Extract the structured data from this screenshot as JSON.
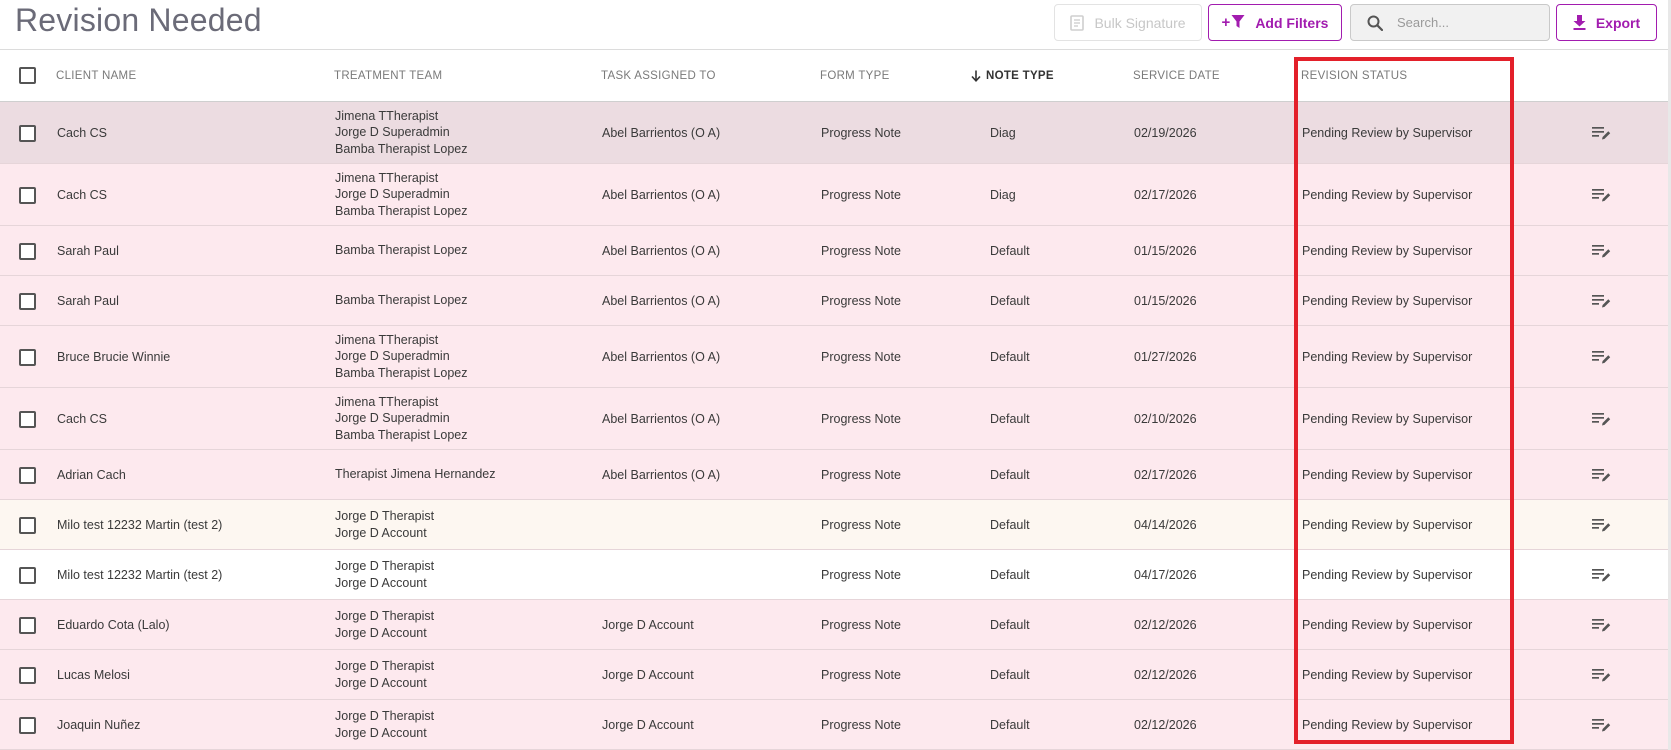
{
  "page": {
    "title": "Revision Needed"
  },
  "toolbar": {
    "bulk_signature_label": "Bulk Signature",
    "add_filters_label": "Add Filters",
    "search_placeholder": "Search...",
    "export_label": "Export",
    "accent_color": "#a21caf"
  },
  "table": {
    "columns": {
      "client_name": "CLIENT NAME",
      "treatment_team": "TREATMENT TEAM",
      "task_assigned_to": "TASK ASSIGNED TO",
      "form_type": "FORM TYPE",
      "note_type": "NOTE TYPE",
      "service_date": "SERVICE DATE",
      "revision_status": "REVISION STATUS"
    },
    "sorted_column": "NOTE TYPE",
    "sort_direction": "descending",
    "rows": [
      {
        "client": "Cach CS",
        "team": [
          "Jimena TTherapist",
          "Jorge D Superadmin",
          "Bamba Therapist Lopez"
        ],
        "assigned": "Abel Barrientos (O A)",
        "form": "Progress Note",
        "note": "Diag",
        "date": "02/19/2026",
        "status": "Pending Review by Supervisor",
        "bg": "#ecdce1"
      },
      {
        "client": "Cach CS",
        "team": [
          "Jimena TTherapist",
          "Jorge D Superadmin",
          "Bamba Therapist Lopez"
        ],
        "assigned": "Abel Barrientos (O A)",
        "form": "Progress Note",
        "note": "Diag",
        "date": "02/17/2026",
        "status": "Pending Review by Supervisor",
        "bg": "#fde9ee"
      },
      {
        "client": "Sarah Paul",
        "team": [
          "Bamba Therapist Lopez"
        ],
        "assigned": "Abel Barrientos (O A)",
        "form": "Progress Note",
        "note": "Default",
        "date": "01/15/2026",
        "status": "Pending Review by Supervisor",
        "bg": "#fde9ee"
      },
      {
        "client": "Sarah Paul",
        "team": [
          "Bamba Therapist Lopez"
        ],
        "assigned": "Abel Barrientos (O A)",
        "form": "Progress Note",
        "note": "Default",
        "date": "01/15/2026",
        "status": "Pending Review by Supervisor",
        "bg": "#fde9ee"
      },
      {
        "client": "Bruce Brucie Winnie",
        "team": [
          "Jimena TTherapist",
          "Jorge D Superadmin",
          "Bamba Therapist Lopez"
        ],
        "assigned": "Abel Barrientos (O A)",
        "form": "Progress Note",
        "note": "Default",
        "date": "01/27/2026",
        "status": "Pending Review by Supervisor",
        "bg": "#fde9ee"
      },
      {
        "client": "Cach CS",
        "team": [
          "Jimena TTherapist",
          "Jorge D Superadmin",
          "Bamba Therapist Lopez"
        ],
        "assigned": "Abel Barrientos (O A)",
        "form": "Progress Note",
        "note": "Default",
        "date": "02/10/2026",
        "status": "Pending Review by Supervisor",
        "bg": "#fde9ee"
      },
      {
        "client": "Adrian Cach",
        "team": [
          "Therapist Jimena Hernandez"
        ],
        "assigned": "Abel Barrientos (O A)",
        "form": "Progress Note",
        "note": "Default",
        "date": "02/17/2026",
        "status": "Pending Review by Supervisor",
        "bg": "#fde9ee"
      },
      {
        "client": "Milo test 12232 Martin (test 2)",
        "team": [
          "Jorge D Therapist",
          "Jorge D Account"
        ],
        "assigned": "",
        "form": "Progress Note",
        "note": "Default",
        "date": "04/14/2026",
        "status": "Pending Review by Supervisor",
        "bg": "#fdf7f1"
      },
      {
        "client": "Milo test 12232 Martin (test 2)",
        "team": [
          "Jorge D Therapist",
          "Jorge D Account"
        ],
        "assigned": "",
        "form": "Progress Note",
        "note": "Default",
        "date": "04/17/2026",
        "status": "Pending Review by Supervisor",
        "bg": "#ffffff"
      },
      {
        "client": "Eduardo Cota (Lalo)",
        "team": [
          "Jorge D Therapist",
          "Jorge D Account"
        ],
        "assigned": "Jorge D Account",
        "form": "Progress Note",
        "note": "Default",
        "date": "02/12/2026",
        "status": "Pending Review by Supervisor",
        "bg": "#fde9ee"
      },
      {
        "client": "Lucas Melosi",
        "team": [
          "Jorge D Therapist",
          "Jorge D Account"
        ],
        "assigned": "Jorge D Account",
        "form": "Progress Note",
        "note": "Default",
        "date": "02/12/2026",
        "status": "Pending Review by Supervisor",
        "bg": "#fde9ee"
      },
      {
        "client": "Joaquin Nuñez",
        "team": [
          "Jorge D Therapist",
          "Jorge D Account"
        ],
        "assigned": "Jorge D Account",
        "form": "Progress Note",
        "note": "Default",
        "date": "02/12/2026",
        "status": "Pending Review by Supervisor",
        "bg": "#fde9ee"
      }
    ]
  },
  "annotation": {
    "highlight_color": "#e3202a"
  }
}
